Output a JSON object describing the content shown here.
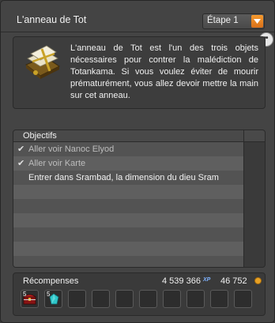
{
  "window": {
    "title": "L'anneau de Tot",
    "step_select": {
      "selected": "Étape 1"
    }
  },
  "description": {
    "text": "L'anneau de Tot est l'un des trois objets nécessaires pour contrer la malédiction de Totankama. Si vous voulez éviter de mourir prématurément, vous allez devoir mettre la main sur cet anneau."
  },
  "objectives": {
    "title": "Objectifs",
    "items": [
      {
        "label": "Aller voir Nanoc Elyod",
        "done": true,
        "check": "✔"
      },
      {
        "label": "Aller voir Karte",
        "done": true,
        "check": "✔"
      },
      {
        "label": "Entrer dans Srambad, la dimension du dieu Sram",
        "done": false,
        "check": ""
      }
    ]
  },
  "rewards": {
    "title": "Récompenses",
    "xp": "4 539 366",
    "xp_icon": "XP",
    "kamas": "46 752",
    "items": [
      {
        "icon": "chest-icon",
        "qty": "5"
      },
      {
        "icon": "gem-icon",
        "qty": "5"
      }
    ]
  },
  "colors": {
    "accent_orange": "#f0902a",
    "background": "#444444"
  }
}
